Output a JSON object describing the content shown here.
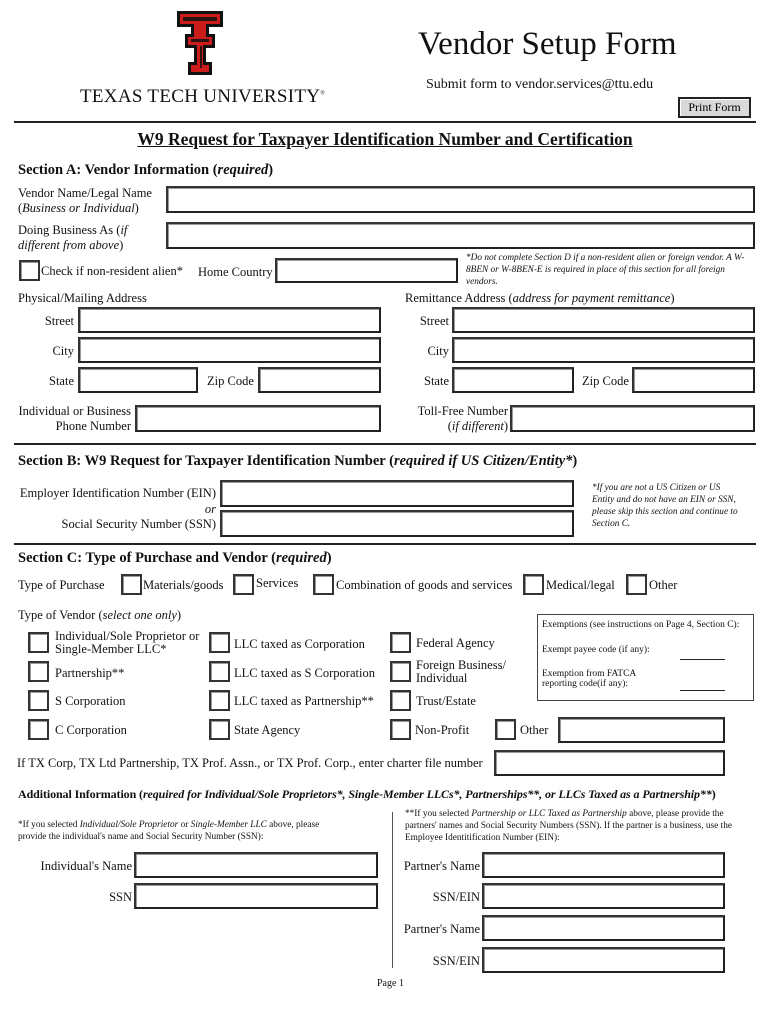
{
  "header": {
    "university": "TEXAS TECH UNIVERSITY",
    "trademark": "®",
    "logo_icon": "double-t-logo",
    "title": "Vendor Setup Form",
    "submit_note": "Submit form to vendor.services@ttu.edu",
    "print_button": "Print Form",
    "form_heading": "W9 Request for Taxpayer Identification Number and Certification"
  },
  "colors": {
    "logo_red": "#cc1c1c",
    "logo_black": "#111111"
  },
  "section_a": {
    "title": "Section A: Vendor Information",
    "qualifier": "required",
    "vendor_name_label_1": "Vendor Name/Legal Name",
    "vendor_name_label_2": "Business or Individual",
    "vendor_name_value": "",
    "dba_label_1": "Doing Business As (",
    "dba_label_1_it": "if",
    "dba_label_2_it": "different from above",
    "dba_value": "",
    "nonresident_label": "Check if non-resident alien*",
    "nonresident_checked": false,
    "home_country_label": "Home Country",
    "home_country_value": "",
    "nonresident_note": "*Do not complete Section D if a non-resident alien or foreign vendor. A W-8BEN or W-8BEN-E is required in place of this section for all foreign vendors.",
    "physical_heading": "Physical/Mailing Address",
    "remit_heading": "Remittance Address (",
    "remit_heading_it": "address for payment remittance",
    "street_label": "Street",
    "city_label": "City",
    "state_label": "State",
    "zip_label": "Zip Code",
    "phone_label_1": "Individual or Business",
    "phone_label_2": "Phone Number",
    "tollfree_label_1": "Toll-Free Number",
    "tollfree_label_2": "if different",
    "physical": {
      "street": "",
      "city": "",
      "state": "",
      "zip": "",
      "phone": ""
    },
    "remit": {
      "street": "",
      "city": "",
      "state": "",
      "zip": "",
      "tollfree": ""
    }
  },
  "section_b": {
    "title": "Section B: W9 Request for Taxpayer Identification Number",
    "qualifier": "required if US Citizen/Entity*",
    "ein_label": "Employer Identification Number (EIN)",
    "or_label": "or",
    "ssn_label": "Social Security Number (SSN)",
    "ein_value": "",
    "ssn_value": "",
    "note": "*If you are not a US Citizen or US Entity and do not have an EIN or SSN, please skip this section and continue to Section C."
  },
  "section_c": {
    "title": "Section C: Type of Purchase and Vendor",
    "qualifier": "required",
    "purchase_label": "Type of Purchase",
    "purchase_options": [
      "Materials/goods",
      "Services",
      "Combination of goods and services",
      "Medical/legal",
      "Other"
    ],
    "vendor_label": "Type of Vendor (",
    "vendor_label_it": "select one only",
    "vendor_col1": [
      "Individual/Sole Proprietor or",
      "Single-Member LLC*",
      "Partnership**",
      "S Corporation",
      "C Corporation"
    ],
    "vendor_col2": [
      "LLC taxed as Corporation",
      "LLC taxed as S Corporation",
      "LLC taxed as Partnership**",
      "State Agency"
    ],
    "vendor_col3": [
      "Federal Agency",
      "Foreign Business/",
      "Individual",
      "Trust/Estate",
      "Non-Profit"
    ],
    "other_label": "Other",
    "other_value": "",
    "exemptions_title": "Exemptions (see instructions on Page 4, Section C):",
    "exempt_payee_label": "Exempt payee code (if any):",
    "fatca_label_1": "Exemption from FATCA",
    "fatca_label_2": "reporting code(if any):",
    "charter_label": "If TX Corp, TX Ltd Partnership, TX Prof. Assn., or TX Prof. Corp., enter charter file number",
    "charter_value": ""
  },
  "additional": {
    "title": "Additional Information (",
    "title_it": "required for Individual/Sole Proprietors*, Single-Member LLCs*, Partnerships**, or LLCs Taxed as a Partnership**",
    "left_note_1": "*If you selected ",
    "left_note_it1": "Individual/Sole Proprietor",
    "left_note_2": " or ",
    "left_note_it2": "Single-Member LLC",
    "left_note_3": " above, please provide the individual's name and Social Security Number (SSN):",
    "right_note_1": "**If you selected ",
    "right_note_it": "Partnership or LLC Taxed as Partnership",
    "right_note_2": " above, please provide the partners' names and Social Security Numbers (SSN). If the partner is a business, use the Employee Identitification Number (EIN):",
    "individual_name_label": "Individual's Name",
    "ssn_label": "SSN",
    "partner_name_label": "Partner's Name",
    "ssn_ein_label": "SSN/EIN"
  },
  "footer": {
    "page": "Page 1"
  }
}
